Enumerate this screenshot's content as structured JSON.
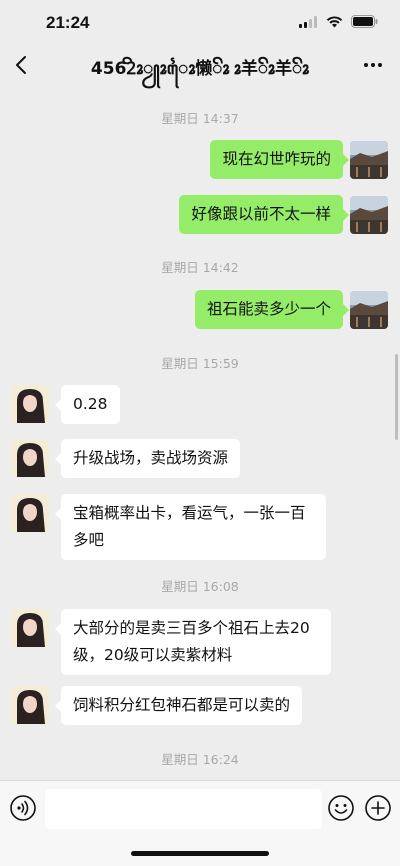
{
  "status": {
    "time": "21:24"
  },
  "header": {
    "title": "4562ꦼꦴꦾꦴꦻꦴ懒ꦼꦴ ꦴ羊ꦼꦴ羊ꦼꦴ"
  },
  "messages": [
    {
      "type": "time",
      "text": "星期日 14:37"
    },
    {
      "type": "sent",
      "text": "现在幻世咋玩的"
    },
    {
      "type": "sent",
      "text": "好像跟以前不太一样"
    },
    {
      "type": "time",
      "text": "星期日 14:42"
    },
    {
      "type": "sent",
      "text": "祖石能卖多少一个"
    },
    {
      "type": "time",
      "text": "星期日 15:59"
    },
    {
      "type": "received",
      "text": "0.28"
    },
    {
      "type": "received",
      "text": "升级战场，卖战场资源"
    },
    {
      "type": "received",
      "line1": "宝箱概率出卡，看运气，一张一百",
      "line2": "多吧"
    },
    {
      "type": "time",
      "text": "星期日 16:08"
    },
    {
      "type": "received",
      "line1": "大部分的是卖三百多个祖石上去20",
      "line2": "级，20级可以卖紫材料"
    },
    {
      "type": "received",
      "text": "饲料积分红包神石都是可以卖的"
    },
    {
      "type": "time",
      "text": "星期日 16:24"
    }
  ],
  "input": {
    "value": ""
  },
  "colors": {
    "sent_bubble": "#95ec69",
    "received_bubble": "#ffffff",
    "background": "#ededed"
  }
}
